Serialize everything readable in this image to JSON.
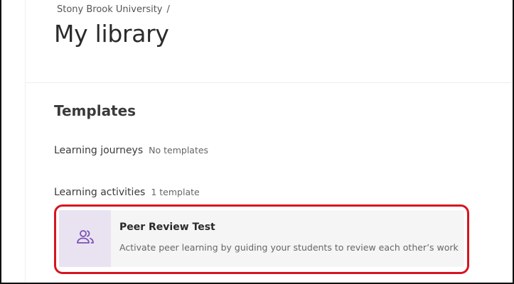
{
  "breadcrumb": {
    "items": [
      "Stony Brook University"
    ],
    "separator": "/"
  },
  "page": {
    "title": "My library"
  },
  "templates": {
    "heading": "Templates",
    "categories": [
      {
        "label": "Learning journeys",
        "count_text": "No templates"
      },
      {
        "label": "Learning activities",
        "count_text": "1 template"
      }
    ],
    "activity_cards": [
      {
        "title": "Peer Review Test",
        "description": "Activate peer learning by guiding your students to review each other’s work",
        "icon": "people-icon"
      }
    ]
  },
  "colors": {
    "highlight": "#d7141f",
    "icon_accent": "#7b52b3",
    "icon_background": "#e9e3f1"
  }
}
